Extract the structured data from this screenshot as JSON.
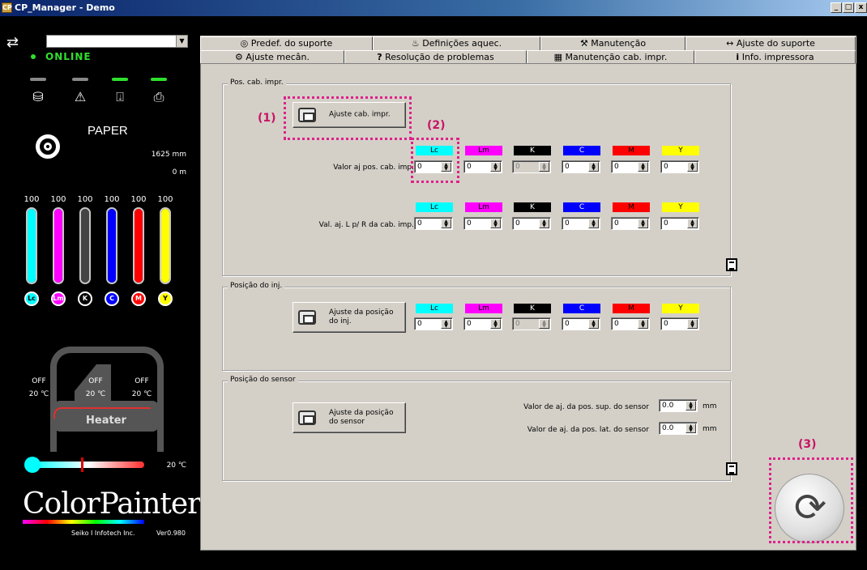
{
  "window": {
    "title": "CP_Manager - Demo",
    "min": "_",
    "max": "□",
    "close": "x"
  },
  "left": {
    "status": "ONLINE",
    "media_name": "PAPER",
    "media_width": "1625 mm",
    "media_remaining": "0 m",
    "ink_levels": [
      {
        "label": "100",
        "code": "Lc",
        "color": "#00ffff",
        "level": 1.0
      },
      {
        "label": "100",
        "code": "Lm",
        "color": "#ff00ff",
        "level": 1.0
      },
      {
        "label": "100",
        "code": "K",
        "color": "#202020",
        "level": 1.0
      },
      {
        "label": "100",
        "code": "C",
        "color": "#0000ff",
        "level": 1.0
      },
      {
        "label": "100",
        "code": "M",
        "color": "#ff0000",
        "level": 1.0
      },
      {
        "label": "100",
        "code": "Y",
        "color": "#ffff00",
        "level": 1.0
      }
    ],
    "heater": {
      "label": "Heater",
      "zones": [
        {
          "state": "OFF",
          "temp": "20 ℃"
        },
        {
          "state": "OFF",
          "temp": "20 ℃"
        },
        {
          "state": "OFF",
          "temp": "20 ℃"
        }
      ],
      "ambient": "20 ℃"
    },
    "brand": "ColorPainter",
    "vendor": "Seiko I Infotech Inc.",
    "version": "Ver0.980"
  },
  "tabs_row1": [
    "Predef. do suporte",
    "Definições aquec.",
    "Manutenção",
    "Ajuste do suporte"
  ],
  "tabs_row2": [
    "Ajuste mecân.",
    "Resolução de problemas",
    "Manutenção cab. impr.",
    "Info. impressora"
  ],
  "colors": [
    "Lc",
    "Lm",
    "K",
    "C",
    "M",
    "Y"
  ],
  "head_pos": {
    "group": "Pos. cab. impr.",
    "button": "Ajuste cab. impr.",
    "row1_label": "Valor aj pos. cab. imp.",
    "row1_values": [
      "0",
      "0",
      "0",
      "0",
      "0",
      "0"
    ],
    "row2_label": "Val. aj. L p/ R da cab. imp.",
    "row2_values": [
      "0",
      "0",
      "0",
      "0",
      "0",
      "0"
    ]
  },
  "inj_pos": {
    "group": "Posição do inj.",
    "button_line1": "Ajuste da posição",
    "button_line2": "do inj.",
    "values": [
      "0",
      "0",
      "0",
      "0",
      "0",
      "0"
    ]
  },
  "sensor_pos": {
    "group": "Posição do sensor",
    "button_line1": "Ajuste da posição",
    "button_line2": "do sensor",
    "top_label": "Valor de aj. da pos. sup. do sensor",
    "top_value": "0.0",
    "side_label": "Valor de aj. da pos. lat. do sensor",
    "side_value": "0.0",
    "unit": "mm"
  },
  "callouts": [
    "(1)",
    "(2)",
    "(3)"
  ]
}
